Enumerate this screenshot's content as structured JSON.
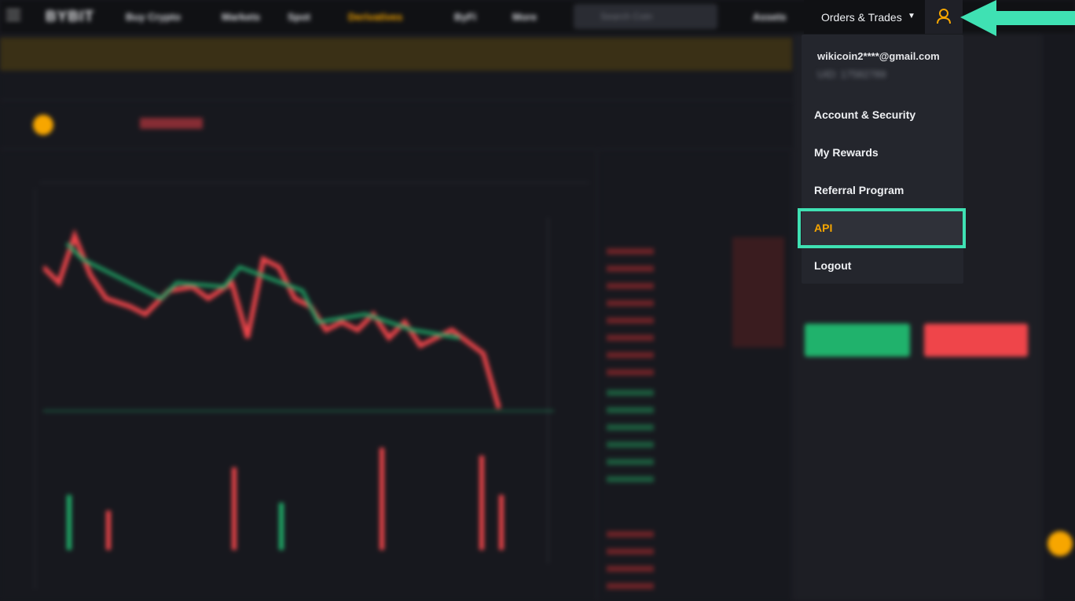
{
  "topbar": {
    "logo": "BYBIT",
    "nav": [
      "Buy Crypto",
      "Markets",
      "Spot",
      "Derivatives",
      "ByFi",
      "More"
    ],
    "search_placeholder": "Search Coin",
    "assets": "Assets",
    "orders_trades": "Orders & Trades"
  },
  "user_menu": {
    "email": "wikicoin2****@gmail.com",
    "uid": "UID: 17582789",
    "items": [
      {
        "label": "Account & Security"
      },
      {
        "label": "My Rewards"
      },
      {
        "label": "Referral Program"
      },
      {
        "label": "API",
        "active": true
      },
      {
        "label": "Logout"
      }
    ]
  },
  "colors": {
    "accent": "#f7a600",
    "highlight": "#3fe1b3",
    "buy": "#20b26c",
    "sell": "#ef454a"
  },
  "icons": {
    "menu": "hamburger-icon",
    "user": "user-icon",
    "search": "search-icon",
    "arrow": "arrow-left-icon"
  }
}
